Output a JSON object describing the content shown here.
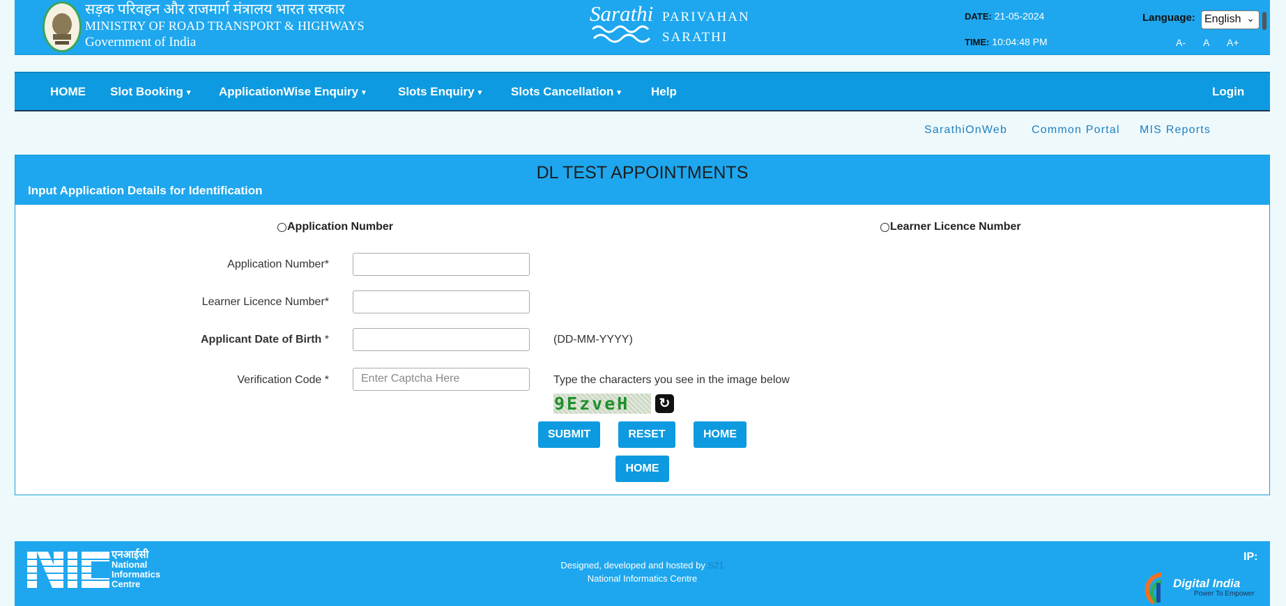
{
  "header": {
    "ministry_hindi": "सड़क परिवहन और राजमार्ग मंत्रालय भारत सरकार",
    "ministry_english": "MINISTRY OF ROAD TRANSPORT & HIGHWAYS",
    "government": "Government of India",
    "logo_text": "Sarathi",
    "brand_line1": "PARIVAHAN",
    "brand_line2": "SARATHI",
    "date_label": "DATE:",
    "date_value": "21-05-2024",
    "time_label": "TIME:",
    "time_value": "10:04:48 PM",
    "language_label": "Language:",
    "language_selected": "English",
    "font_decrease": "A-",
    "font_normal": "A",
    "font_increase": "A+"
  },
  "nav": {
    "items": [
      {
        "label": "HOME",
        "dropdown": false
      },
      {
        "label": "Slot Booking",
        "dropdown": true
      },
      {
        "label": "ApplicationWise Enquiry",
        "dropdown": true
      },
      {
        "label": "Slots Enquiry",
        "dropdown": true
      },
      {
        "label": "Slots Cancellation",
        "dropdown": true
      },
      {
        "label": "Help",
        "dropdown": false
      }
    ],
    "login": "Login"
  },
  "quick_links": [
    "SarathiOnWeb",
    "Common Portal",
    "MIS Reports"
  ],
  "panel": {
    "title": "DL TEST APPOINTMENTS",
    "subtitle": "Input Application Details for Identification",
    "radio_application": "Application Number",
    "radio_learner": "Learner Licence Number",
    "fields": {
      "application_number_label": "Application Number*",
      "learner_licence_label": "Learner Licence Number*",
      "dob_label": "Applicant Date of Birth",
      "dob_hint": "(DD-MM-YYYY)",
      "verification_label": "Verification Code *",
      "captcha_placeholder": "Enter Captcha Here",
      "captcha_hint": "Type the characters you see in the image below",
      "captcha_text": "9EzveH"
    },
    "buttons": {
      "submit": "SUBMIT",
      "reset": "RESET",
      "home": "HOME",
      "home2": "HOME"
    }
  },
  "footer": {
    "nic_hindi": "एनआईसी",
    "nic_line1": "National",
    "nic_line2": "Informatics",
    "nic_line3": "Centre",
    "designed_by": "Designed, developed and hosted by",
    "server_link": "S21",
    "organisation": "National Informatics Centre",
    "ip_label": "IP:",
    "digital_india": "Digital India",
    "digital_india_tagline": "Power To Empower"
  },
  "colors": {
    "header_blue": "#1ea7ee",
    "nav_blue": "#0d9ae0",
    "page_bg": "#eef9fc",
    "link_blue": "#1e7fbf"
  }
}
